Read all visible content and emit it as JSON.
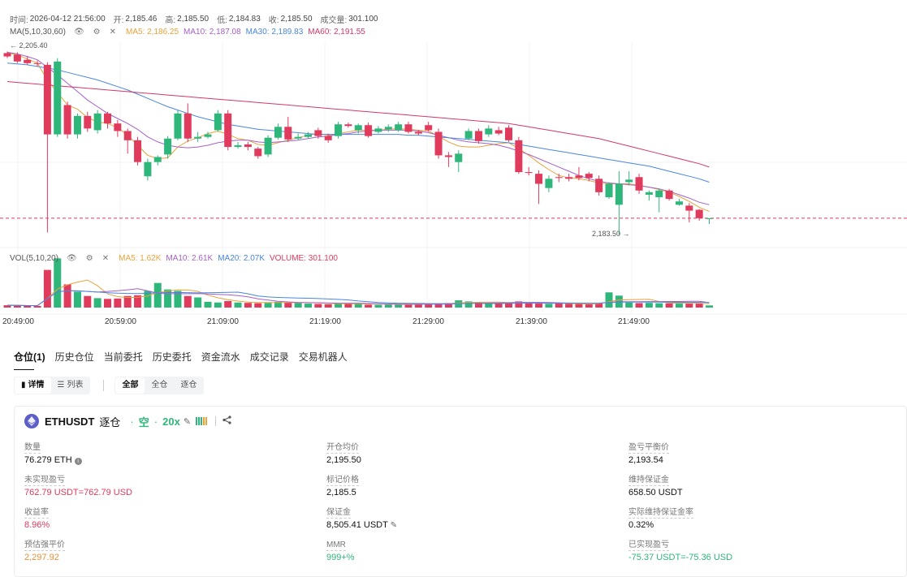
{
  "colors": {
    "up": "#2fb67a",
    "down": "#e03a5c",
    "ma5": "#e8a33b",
    "ma10": "#a461c7",
    "ma30": "#4a86e0",
    "ma60": "#d4386a"
  },
  "header": {
    "time_label": "时间:",
    "time_value": "2026-04-12 21:56:00",
    "open_label": "开:",
    "open_value": "2,185.46",
    "high_label": "高:",
    "high_value": "2,185.50",
    "low_label": "低:",
    "low_value": "2,184.83",
    "close_label": "收:",
    "close_value": "2,185.50",
    "volume_label": "成交量:",
    "volume_value": "301.100"
  },
  "ma_line": {
    "name": "MA(5,10,30,60)",
    "ma5": "MA5: 2,186.25",
    "ma10": "MA10: 2,187.08",
    "ma30": "MA30: 2,189.83",
    "ma60": "MA60: 2,191.55"
  },
  "vol_line": {
    "name": "VOL(5,10,20)",
    "ma5": "MA5: 1.62K",
    "ma10": "MA10: 2.61K",
    "ma20": "MA20: 2.07K",
    "volume": "VOLUME: 301.100"
  },
  "chart_data": {
    "type": "candlestick",
    "max_label": "2,205.40",
    "min_label": "2,183.50",
    "x_ticks": [
      "20:49:00",
      "20:59:00",
      "21:09:00",
      "21:19:00",
      "21:29:00",
      "21:39:00",
      "21:49:00"
    ],
    "candles": [
      [
        2205.2,
        2204.8,
        2205.4,
        2204.6
      ],
      [
        2205.0,
        2204.2,
        2205.3,
        2204.0
      ],
      [
        2204.4,
        2204.0,
        2204.8,
        2203.8
      ],
      [
        2204.0,
        2203.9,
        2204.3,
        2203.6
      ],
      [
        2203.8,
        2195.5,
        2204.1,
        2183.8
      ],
      [
        2195.5,
        2204.2,
        2204.6,
        2195.2
      ],
      [
        2199.0,
        2195.5,
        2199.4,
        2195.0
      ],
      [
        2195.5,
        2197.7,
        2198.0,
        2195.0
      ],
      [
        2197.7,
        2196.2,
        2198.2,
        2195.8
      ],
      [
        2196.0,
        2198.0,
        2198.4,
        2195.6
      ],
      [
        2198.0,
        2196.8,
        2198.2,
        2196.2
      ],
      [
        2196.8,
        2195.9,
        2197.2,
        2195.2
      ],
      [
        2195.9,
        2194.8,
        2196.2,
        2193.2
      ],
      [
        2194.8,
        2192.2,
        2195.2,
        2191.8
      ],
      [
        2190.5,
        2192.2,
        2192.6,
        2190.0
      ],
      [
        2192.2,
        2192.8,
        2193.0,
        2191.8
      ],
      [
        2193.1,
        2195.0,
        2195.3,
        2192.6
      ],
      [
        2195.0,
        2198.0,
        2198.4,
        2194.8
      ],
      [
        2198.0,
        2195.0,
        2199.2,
        2194.6
      ],
      [
        2195.0,
        2195.2,
        2195.8,
        2194.6
      ],
      [
        2195.2,
        2195.5,
        2195.8,
        2195.0
      ],
      [
        2196.0,
        2198.0,
        2198.4,
        2195.8
      ],
      [
        2198.0,
        2194.0,
        2198.4,
        2193.6
      ],
      [
        2194.0,
        2194.2,
        2194.6,
        2193.8
      ],
      [
        2194.3,
        2194.0,
        2194.6,
        2193.6
      ],
      [
        2193.8,
        2192.9,
        2194.0,
        2192.6
      ],
      [
        2193.1,
        2195.1,
        2195.4,
        2192.8
      ],
      [
        2195.1,
        2196.4,
        2196.8,
        2194.9
      ],
      [
        2196.4,
        2194.9,
        2197.6,
        2194.6
      ],
      [
        2195.0,
        2195.2,
        2195.6,
        2194.8
      ],
      [
        2195.2,
        2195.5,
        2195.8,
        2195.0
      ],
      [
        2196.0,
        2195.3,
        2196.3,
        2195.0
      ],
      [
        2195.3,
        2194.8,
        2195.6,
        2194.5
      ],
      [
        2195.3,
        2196.7,
        2197.0,
        2195.0
      ],
      [
        2196.7,
        2196.5,
        2196.9,
        2196.3
      ],
      [
        2196.0,
        2196.6,
        2196.8,
        2195.6
      ],
      [
        2196.6,
        2195.3,
        2196.9,
        2195.1
      ],
      [
        2195.8,
        2196.2,
        2196.5,
        2195.6
      ],
      [
        2196.1,
        2196.4,
        2196.7,
        2195.8
      ],
      [
        2196.0,
        2196.7,
        2197.0,
        2195.8
      ],
      [
        2196.7,
        2195.8,
        2197.0,
        2195.6
      ],
      [
        2195.8,
        2195.6,
        2196.0,
        2195.4
      ],
      [
        2196.6,
        2196.0,
        2197.0,
        2195.8
      ],
      [
        2195.8,
        2193.0,
        2196.2,
        2192.6
      ],
      [
        2193.0,
        2192.8,
        2193.4,
        2191.6
      ],
      [
        2192.2,
        2193.2,
        2193.6,
        2191.0
      ],
      [
        2195.0,
        2195.9,
        2196.2,
        2194.8
      ],
      [
        2195.9,
        2194.7,
        2196.2,
        2194.4
      ],
      [
        2195.5,
        2196.2,
        2196.6,
        2195.2
      ],
      [
        2196.0,
        2195.6,
        2196.4,
        2195.4
      ],
      [
        2196.3,
        2194.8,
        2196.6,
        2194.6
      ],
      [
        2194.8,
        2191.0,
        2195.2,
        2190.8
      ],
      [
        2191.0,
        2190.9,
        2191.6,
        2190.6
      ],
      [
        2190.8,
        2189.6,
        2191.2,
        2187.2
      ],
      [
        2189.1,
        2190.2,
        2190.6,
        2188.6
      ],
      [
        2190.4,
        2190.3,
        2190.8,
        2189.8
      ],
      [
        2190.4,
        2190.2,
        2190.8,
        2189.9
      ],
      [
        2190.6,
        2190.3,
        2191.6,
        2190.0
      ],
      [
        2190.8,
        2190.3,
        2191.0,
        2189.9
      ],
      [
        2190.2,
        2188.6,
        2190.6,
        2188.2
      ],
      [
        2188.0,
        2189.6,
        2189.8,
        2187.8
      ],
      [
        2187.1,
        2189.6,
        2191.1,
        2183.5
      ],
      [
        2189.8,
        2190.1,
        2191.1,
        2189.4
      ],
      [
        2190.4,
        2188.8,
        2190.8,
        2188.4
      ],
      [
        2188.3,
        2188.6,
        2188.8,
        2187.6
      ],
      [
        2188.0,
        2188.8,
        2189.0,
        2186.2
      ],
      [
        2188.8,
        2187.8,
        2189.0,
        2187.6
      ],
      [
        2187.1,
        2187.5,
        2187.8,
        2187.0
      ],
      [
        2187.0,
        2186.4,
        2187.3,
        2185.0
      ],
      [
        2186.5,
        2185.5,
        2186.6,
        2185.2
      ],
      [
        2185.5,
        2185.5,
        2185.5,
        2184.8
      ]
    ],
    "volumes": [
      320,
      280,
      250,
      230,
      5200,
      6800,
      3200,
      2200,
      1600,
      1300,
      1200,
      1250,
      1600,
      1700,
      2300,
      3400,
      2500,
      2300,
      1600,
      1400,
      800,
      700,
      900,
      700,
      650,
      600,
      650,
      800,
      700,
      650,
      550,
      500,
      450,
      550,
      600,
      550,
      400,
      380,
      420,
      450,
      500,
      480,
      500,
      550,
      620,
      1000,
      850,
      700,
      600,
      650,
      700,
      850,
      650,
      550,
      500,
      600,
      520,
      500,
      450,
      550,
      2100,
      1650,
      700,
      620,
      650,
      600,
      580,
      550,
      600,
      620,
      301
    ],
    "ma_series": {
      "MA5": [
        2205.2,
        2205.0,
        2204.5,
        2204.0,
        2202.0,
        2200.5,
        2199.0,
        2198.5,
        2197.5,
        2197.0,
        2196.8,
        2196.3,
        2195.4,
        2194.2,
        2193.0,
        2192.6,
        2192.7,
        2194.0,
        2194.7,
        2195.1,
        2195.6,
        2195.9,
        2195.5,
        2195.0,
        2194.8,
        2194.3,
        2194.2,
        2194.5,
        2194.8,
        2195.1,
        2195.4,
        2195.6,
        2195.4,
        2195.6,
        2195.8,
        2196.0,
        2196.0,
        2196.0,
        2196.1,
        2196.2,
        2196.1,
        2196.0,
        2195.9,
        2195.3,
        2194.6,
        2194.1,
        2194.0,
        2194.0,
        2194.2,
        2194.4,
        2194.5,
        2193.8,
        2193.0,
        2192.1,
        2191.3,
        2190.6,
        2190.3,
        2190.2,
        2190.0,
        2189.7,
        2189.6,
        2189.6,
        2189.6,
        2189.4,
        2189.2,
        2188.9,
        2188.6,
        2188.1,
        2187.5,
        2186.8,
        2186.3
      ],
      "MA10": [
        2205.3,
        2205.1,
        2204.8,
        2204.4,
        2203.5,
        2202.6,
        2201.6,
        2200.6,
        2199.6,
        2198.8,
        2198.0,
        2197.4,
        2196.8,
        2196.1,
        2195.2,
        2194.6,
        2194.2,
        2194.0,
        2193.9,
        2194.0,
        2194.2,
        2194.5,
        2194.7,
        2194.8,
        2194.8,
        2194.6,
        2194.5,
        2194.6,
        2194.7,
        2194.8,
        2195.0,
        2195.2,
        2195.3,
        2195.5,
        2195.6,
        2195.8,
        2195.9,
        2196.0,
        2196.0,
        2196.0,
        2196.0,
        2195.9,
        2195.7,
        2195.4,
        2195.1,
        2194.8,
        2194.6,
        2194.5,
        2194.4,
        2194.2,
        2193.9,
        2193.5,
        2193.1,
        2192.6,
        2192.1,
        2191.6,
        2191.1,
        2190.6,
        2190.2,
        2189.9,
        2189.7,
        2189.6,
        2189.5,
        2189.4,
        2189.2,
        2189.0,
        2188.7,
        2188.3,
        2187.9,
        2187.4,
        2187.1
      ],
      "MA30": [
        2204.0,
        2203.9,
        2203.8,
        2203.6,
        2203.4,
        2203.2,
        2202.9,
        2202.6,
        2202.3,
        2202.0,
        2201.6,
        2201.2,
        2200.8,
        2200.3,
        2199.8,
        2199.3,
        2198.8,
        2198.4,
        2198.0,
        2197.6,
        2197.3,
        2197.0,
        2196.7,
        2196.5,
        2196.3,
        2196.1,
        2196.0,
        2195.9,
        2195.8,
        2195.7,
        2195.6,
        2195.5,
        2195.5,
        2195.5,
        2195.5,
        2195.5,
        2195.5,
        2195.5,
        2195.5,
        2195.5,
        2195.4,
        2195.4,
        2195.3,
        2195.2,
        2195.1,
        2195.0,
        2194.9,
        2194.8,
        2194.7,
        2194.6,
        2194.5,
        2194.3,
        2194.1,
        2193.9,
        2193.7,
        2193.5,
        2193.3,
        2193.1,
        2192.9,
        2192.7,
        2192.5,
        2192.3,
        2192.1,
        2191.9,
        2191.7,
        2191.4,
        2191.1,
        2190.8,
        2190.5,
        2190.2,
        2189.8
      ],
      "MA60": [
        2201.8,
        2201.7,
        2201.6,
        2201.5,
        2201.4,
        2201.3,
        2201.2,
        2201.1,
        2201.0,
        2200.9,
        2200.8,
        2200.7,
        2200.6,
        2200.5,
        2200.4,
        2200.3,
        2200.2,
        2200.1,
        2200.0,
        2199.9,
        2199.8,
        2199.7,
        2199.6,
        2199.5,
        2199.4,
        2199.3,
        2199.2,
        2199.1,
        2199.0,
        2198.9,
        2198.8,
        2198.7,
        2198.6,
        2198.5,
        2198.4,
        2198.3,
        2198.2,
        2198.1,
        2198.0,
        2197.9,
        2197.8,
        2197.7,
        2197.6,
        2197.5,
        2197.4,
        2197.3,
        2197.2,
        2197.1,
        2197.0,
        2196.9,
        2196.8,
        2196.6,
        2196.4,
        2196.2,
        2196.0,
        2195.8,
        2195.6,
        2195.4,
        2195.2,
        2195.0,
        2194.7,
        2194.4,
        2194.1,
        2193.8,
        2193.5,
        2193.2,
        2192.9,
        2192.6,
        2192.3,
        2192.0,
        2191.6
      ]
    }
  },
  "tabs": [
    {
      "label": "仓位(1)",
      "active": true
    },
    {
      "label": "历史仓位"
    },
    {
      "label": "当前委托"
    },
    {
      "label": "历史委托"
    },
    {
      "label": "资金流水"
    },
    {
      "label": "成交记录"
    },
    {
      "label": "交易机器人"
    }
  ],
  "view_toggle": {
    "detail": "详情",
    "list": "列表"
  },
  "filter_toggle": {
    "all": "全部",
    "cross": "全仓",
    "isolated": "逐仓"
  },
  "position": {
    "symbol": "ETHUSDT",
    "mode": "逐仓",
    "side": "空",
    "leverage": "20x",
    "fields": {
      "qty_label": "数量",
      "qty_value": "76.279 ETH",
      "upnl_label": "未实现盈亏",
      "upnl_value": "762.79 USDT=762.79 USD",
      "roe_label": "收益率",
      "roe_value": "8.96%",
      "liq_label": "预估强平价",
      "liq_value": "2,297.92",
      "entry_label": "开仓均价",
      "entry_value": "2,195.50",
      "mark_label": "标记价格",
      "mark_value": "2,185.5",
      "margin_label": "保证金",
      "margin_value": "8,505.41 USDT",
      "mmr_label": "MMR",
      "mmr_value": "999+%",
      "be_label": "盈亏平衡价",
      "be_value": "2,193.54",
      "maint_label": "维持保证金",
      "maint_value": "658.50 USDT",
      "mmr_actual_label": "实际维持保证金率",
      "mmr_actual_value": "0.32%",
      "rpnl_label": "已实现盈亏",
      "rpnl_value": "-75.37 USDT=-75.36 USD"
    }
  }
}
